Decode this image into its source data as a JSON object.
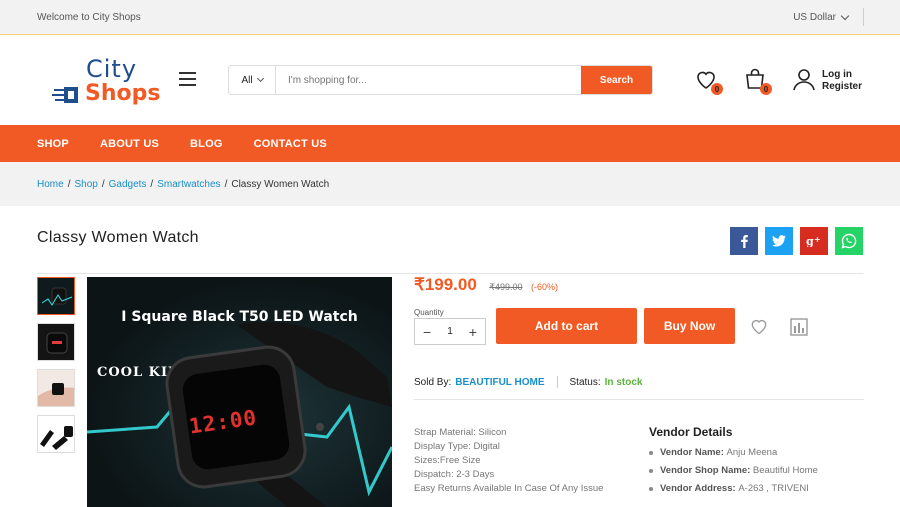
{
  "topbar": {
    "welcome": "Welcome to City Shops",
    "currency": "US Dollar"
  },
  "logo": {
    "line1": "City",
    "line2": "Shops"
  },
  "search": {
    "category": "All",
    "placeholder": "I'm shopping for...",
    "button": "Search"
  },
  "header": {
    "wishlist_count": "0",
    "cart_count": "0",
    "login": "Log in",
    "register": "Register"
  },
  "nav": [
    "SHOP",
    "ABOUT US",
    "BLOG",
    "CONTACT US"
  ],
  "breadcrumb": {
    "home": "Home",
    "shop": "Shop",
    "gadgets": "Gadgets",
    "smartwatches": "Smartwatches",
    "current": "Classy Women Watch",
    "separator": "/"
  },
  "product": {
    "title": "Classy Women Watch",
    "price": "₹199.00",
    "old_price": "₹499.00",
    "discount": "(-60%)",
    "quantity_label": "Quantity",
    "quantity": "1",
    "add_to_cart": "Add to cart",
    "buy_now": "Buy Now",
    "sold_by_label": "Sold By:",
    "sold_by": "BEAUTIFUL HOME",
    "status_label": "Status:",
    "status": "In stock",
    "image_title": "I Square Black T50 LED Watch",
    "image_subtitle": "COOL KID",
    "image_display": "12:00",
    "specs": [
      "Strap Material: Silicon",
      "Display Type: Digital",
      "Sizes:Free Size",
      "Dispatch: 2-3 Days",
      "Easy Returns Available In Case Of Any Issue"
    ]
  },
  "vendor": {
    "heading": "Vendor Details",
    "name_label": "Vendor Name:",
    "name": "Anju Meena",
    "shop_label": "Vendor Shop Name:",
    "shop": "Beautiful Home",
    "address_label": "Vendor Address:",
    "address": "A-263 , TRIVENI"
  },
  "colors": {
    "accent": "#f15a24",
    "link": "#1a8fc9",
    "stock": "#5bb33e",
    "facebook": "#3b5998",
    "twitter": "#1da1f2",
    "googleplus": "#d62d20",
    "whatsapp": "#25d366"
  }
}
